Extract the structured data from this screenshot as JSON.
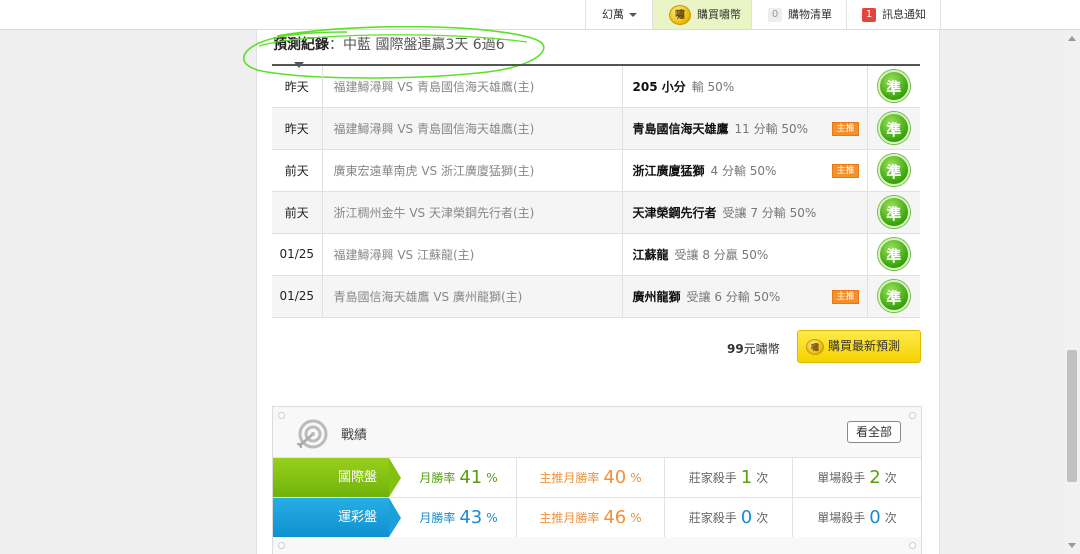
{
  "topbar": {
    "menu_label": "幻萬",
    "buy_coins_label": "購買嘯幣",
    "coin_text": "嘯",
    "cart_count": "0",
    "cart_label": "購物清單",
    "notify_count": "1",
    "notify_label": "訊息通知"
  },
  "record": {
    "title": "預測紀錄",
    "subtitle": "：中藍 國際盤連贏3天 6過6",
    "rows": [
      {
        "date": "昨天",
        "match": "福建鱘潯興 VS 青島國信海天雄鷹(主)",
        "team": "205 小分",
        "line": "輸 50%",
        "tag": "",
        "result": "準"
      },
      {
        "date": "昨天",
        "match": "福建鱘潯興 VS 青島國信海天雄鷹(主)",
        "team": "青島國信海天雄鷹",
        "line": "11 分輸 50%",
        "tag": "主推",
        "result": "準"
      },
      {
        "date": "前天",
        "match": "廣東宏遠華南虎 VS 浙江廣廈猛獅(主)",
        "team": "浙江廣廈猛獅",
        "line": "4 分輸 50%",
        "tag": "主推",
        "result": "準"
      },
      {
        "date": "前天",
        "match": "浙江稠州金牛 VS 天津榮鋼先行者(主)",
        "team": "天津榮鋼先行者",
        "line": "受讓 7 分輸 50%",
        "tag": "",
        "result": "準"
      },
      {
        "date": "01/25",
        "match": "福建鱘潯興 VS 江蘇龍(主)",
        "team": "江蘇龍",
        "line": "受讓 8 分贏 50%",
        "tag": "",
        "result": "準"
      },
      {
        "date": "01/25",
        "match": "青島國信海天雄鷹 VS 廣州龍獅(主)",
        "team": "廣州龍獅",
        "line": "受讓 6 分輸 50%",
        "tag": "主推",
        "result": "準"
      }
    ],
    "price_value": "99",
    "price_unit": "元嘯幣",
    "buy_button": "購買最新預測"
  },
  "stats": {
    "title": "戰績",
    "view_all": "看全部",
    "rows": [
      {
        "label": "國際盤",
        "win_label": "月勝率",
        "win_value": "41",
        "main_label": "主推月勝率",
        "main_value": "40",
        "pct": "%",
        "banker_label": "莊家殺手",
        "banker_value": "1",
        "single_label": "單場殺手",
        "single_value": "2",
        "unit": "次"
      },
      {
        "label": "運彩盤",
        "win_label": "月勝率",
        "win_value": "43",
        "main_label": "主推月勝率",
        "main_value": "46",
        "pct": "%",
        "banker_label": "莊家殺手",
        "banker_value": "0",
        "single_label": "單場殺手",
        "single_value": "0",
        "unit": "次"
      }
    ]
  },
  "colors": {
    "accent_green": "#3ea80e",
    "intl_green": "#82c012",
    "lottery_blue": "#1ba0dc",
    "main_orange": "#f5912b",
    "buy_yellow": "#f5d300",
    "annotation_green": "#5ee02a"
  }
}
